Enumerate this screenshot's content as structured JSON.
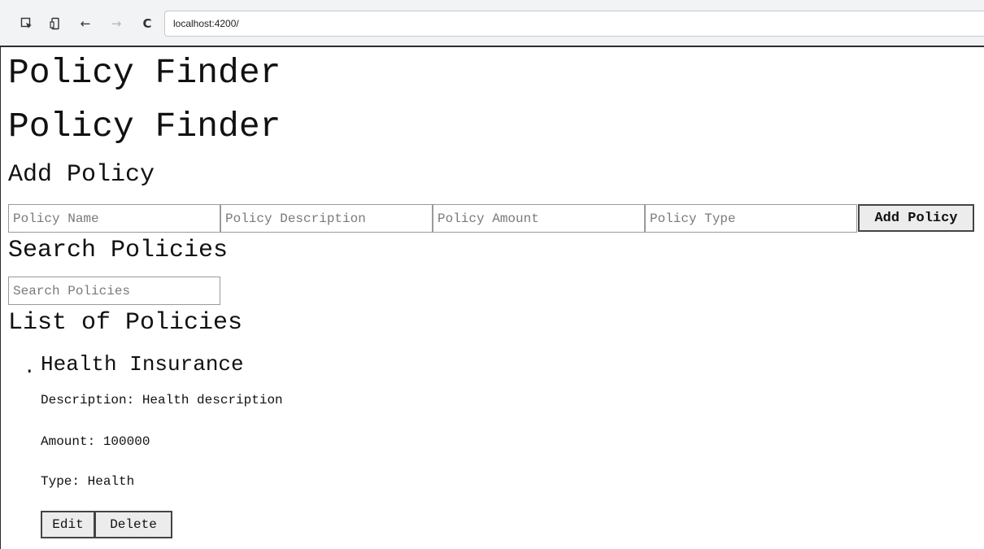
{
  "browser": {
    "url": "localhost:4200/"
  },
  "page": {
    "app_title": "Policy Finder",
    "page_title": "Policy Finder",
    "add_section": {
      "heading": "Add Policy",
      "name_placeholder": "Policy Name",
      "description_placeholder": "Policy Description",
      "amount_placeholder": "Policy Amount",
      "type_placeholder": "Policy Type",
      "add_button_label": "Add Policy"
    },
    "search_section": {
      "heading": "Search Policies",
      "search_placeholder": "Search Policies"
    },
    "list_section": {
      "heading": "List of Policies",
      "policies": [
        {
          "name": "Health Insurance",
          "description_label": "Description:",
          "description": "Health description",
          "amount_label": "Amount:",
          "amount": "100000",
          "type_label": "Type:",
          "type": "Health",
          "edit_label": "Edit",
          "delete_label": "Delete"
        }
      ]
    }
  }
}
